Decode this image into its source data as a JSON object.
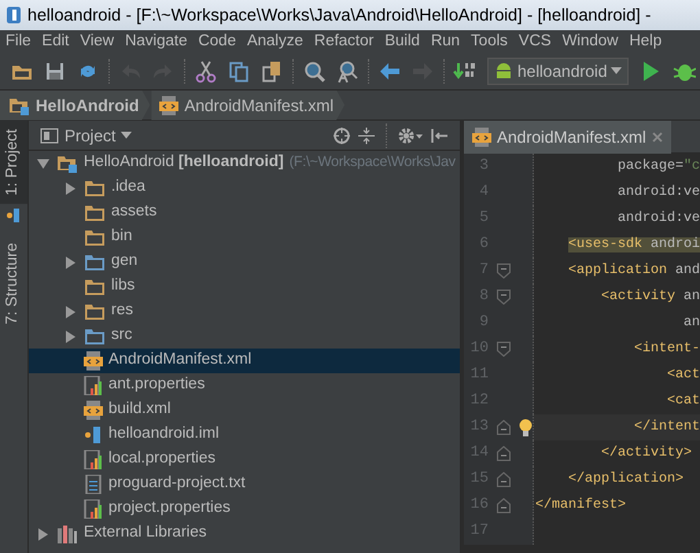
{
  "window": {
    "title": "helloandroid - [F:\\~Workspace\\Works\\Java\\Android\\HelloAndroid] - [helloandroid] -"
  },
  "menu": [
    "File",
    "Edit",
    "View",
    "Navigate",
    "Code",
    "Analyze",
    "Refactor",
    "Build",
    "Run",
    "Tools",
    "VCS",
    "Window",
    "Help"
  ],
  "toolbar": [
    {
      "kind": "open",
      "disabled": false
    },
    {
      "kind": "save",
      "disabled": false
    },
    {
      "kind": "sync",
      "disabled": false
    },
    {
      "kind": "sep"
    },
    {
      "kind": "undo",
      "disabled": true
    },
    {
      "kind": "redo",
      "disabled": true
    },
    {
      "kind": "sep"
    },
    {
      "kind": "cut",
      "disabled": false
    },
    {
      "kind": "copy",
      "disabled": false
    },
    {
      "kind": "paste",
      "disabled": false
    },
    {
      "kind": "sep"
    },
    {
      "kind": "find",
      "disabled": false
    },
    {
      "kind": "replace",
      "disabled": false
    },
    {
      "kind": "sep"
    },
    {
      "kind": "back",
      "disabled": false
    },
    {
      "kind": "forward",
      "disabled": true
    },
    {
      "kind": "sep"
    },
    {
      "kind": "make",
      "disabled": false
    },
    {
      "kind": "config",
      "label": "helloandroid"
    },
    {
      "kind": "run",
      "disabled": false
    },
    {
      "kind": "debug",
      "disabled": false
    }
  ],
  "breadcrumb": [
    {
      "kind": "module",
      "label": "HelloAndroid"
    },
    {
      "kind": "xml",
      "label": "AndroidManifest.xml"
    }
  ],
  "side_tabs": [
    {
      "label": "1: Project",
      "selected": true
    },
    {
      "label": "7: Structure",
      "selected": false
    }
  ],
  "project_panel": {
    "title": "Project",
    "tree": [
      {
        "kind": "module",
        "label": "HelloAndroid **[helloandroid]**",
        "path": "(F:\\~Workspace\\Works\\Jav",
        "expanded": true,
        "selected": false,
        "children": [
          {
            "kind": "folder",
            "label": ".idea",
            "expanded": false,
            "selected": false
          },
          {
            "kind": "folder",
            "label": "assets",
            "selected": false
          },
          {
            "kind": "folder",
            "label": "bin",
            "selected": false
          },
          {
            "kind": "source",
            "label": "gen",
            "expanded": false,
            "selected": false
          },
          {
            "kind": "folder",
            "label": "libs",
            "selected": false
          },
          {
            "kind": "folder",
            "label": "res",
            "expanded": false,
            "selected": false
          },
          {
            "kind": "source",
            "label": "src",
            "expanded": false,
            "selected": false
          },
          {
            "kind": "xml",
            "label": "AndroidManifest.xml",
            "selected": true
          },
          {
            "kind": "properties",
            "label": "ant.properties",
            "selected": false
          },
          {
            "kind": "xml",
            "label": "build.xml",
            "selected": false
          },
          {
            "kind": "iml",
            "label": "helloandroid.iml",
            "selected": false
          },
          {
            "kind": "properties",
            "label": "local.properties",
            "selected": false
          },
          {
            "kind": "text",
            "label": "proguard-project.txt",
            "selected": false
          },
          {
            "kind": "properties",
            "label": "project.properties",
            "selected": false
          }
        ]
      },
      {
        "kind": "libraries",
        "label": "External Libraries",
        "expanded": false,
        "selected": false
      }
    ]
  },
  "editor": {
    "tab": {
      "label": "AndroidManifest.xml",
      "selected": true
    },
    "lines": [
      {
        "number": "3",
        "tokens": [
          {
            "kind": "attr",
            "text": "          package="
          },
          {
            "kind": "value",
            "text": "\"c"
          }
        ]
      },
      {
        "number": "4",
        "tokens": [
          {
            "kind": "attr",
            "text": "          android:ve"
          }
        ]
      },
      {
        "number": "5",
        "tokens": [
          {
            "kind": "attr",
            "text": "          android:ve"
          }
        ]
      },
      {
        "number": "6",
        "highlighted": true,
        "tokens": [
          {
            "kind": "tag",
            "text": "    <uses-sdk"
          },
          {
            "kind": "attr",
            "text": " androi"
          }
        ]
      },
      {
        "number": "7",
        "fold_start": true,
        "tokens": [
          {
            "kind": "tag",
            "text": "    <application"
          },
          {
            "kind": "attr",
            "text": " and"
          }
        ]
      },
      {
        "number": "8",
        "fold_start": true,
        "tokens": [
          {
            "kind": "tag",
            "text": "        <activity"
          },
          {
            "kind": "attr",
            "text": " an"
          }
        ]
      },
      {
        "number": "9",
        "tokens": [
          {
            "kind": "attr",
            "text": "                  an"
          }
        ]
      },
      {
        "number": "10",
        "fold_start": true,
        "tokens": [
          {
            "kind": "tag",
            "text": "            <intent-"
          }
        ]
      },
      {
        "number": "11",
        "tokens": [
          {
            "kind": "tag",
            "text": "                <act"
          }
        ]
      },
      {
        "number": "12",
        "tokens": [
          {
            "kind": "tag",
            "text": "                <cat"
          }
        ]
      },
      {
        "number": "13",
        "fold_end": true,
        "current": true,
        "bulb": true,
        "tokens": [
          {
            "kind": "tag",
            "text": "            </intent"
          }
        ]
      },
      {
        "number": "14",
        "fold_end": true,
        "tokens": [
          {
            "kind": "tag",
            "text": "        </activity>"
          }
        ]
      },
      {
        "number": "15",
        "fold_end": true,
        "tokens": [
          {
            "kind": "tag",
            "text": "    </application>"
          }
        ]
      },
      {
        "number": "16",
        "fold_end": true,
        "tokens": [
          {
            "kind": "tag",
            "text": "</manifest>"
          }
        ]
      },
      {
        "number": "17"
      }
    ]
  }
}
